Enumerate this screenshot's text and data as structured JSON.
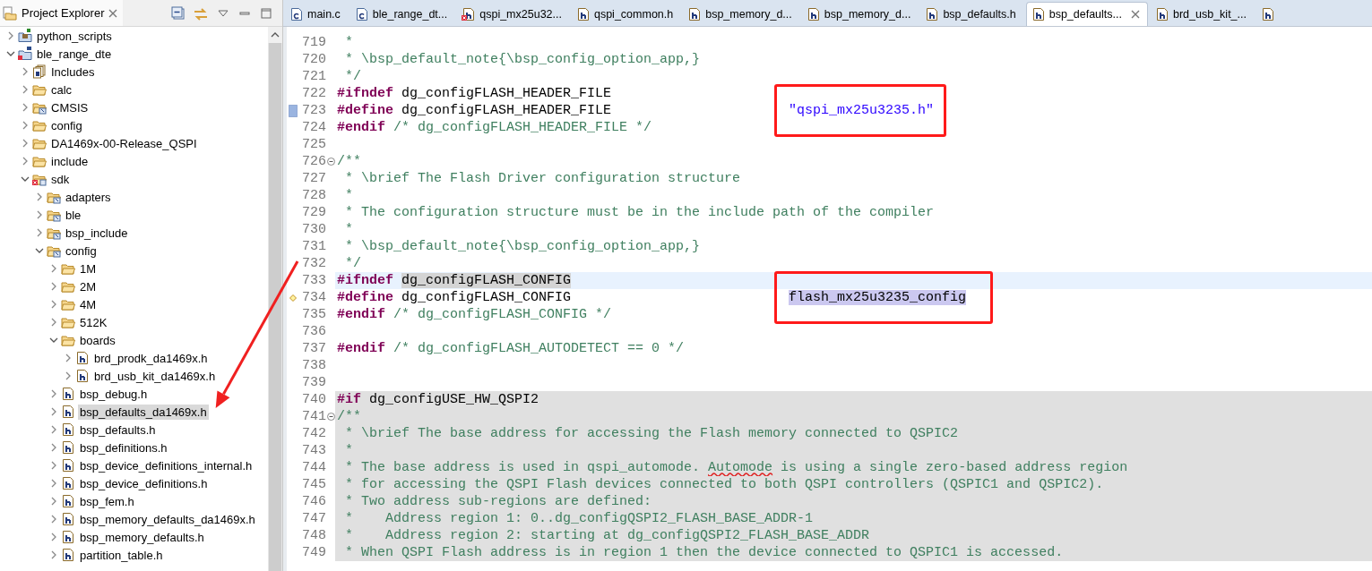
{
  "explorer": {
    "title": "Project Explorer",
    "tree": [
      {
        "label": "python_scripts",
        "kind": "python-project",
        "expanded": false,
        "selected": false
      },
      {
        "label": "ble_range_dte",
        "kind": "c-project",
        "expanded": true,
        "selected": false,
        "children": [
          {
            "label": "Includes",
            "kind": "includes",
            "expanded": false,
            "selected": false
          },
          {
            "label": "calc",
            "kind": "folder",
            "expanded": false,
            "selected": false
          },
          {
            "label": "CMSIS",
            "kind": "linked-folder",
            "expanded": false,
            "selected": false
          },
          {
            "label": "config",
            "kind": "folder",
            "expanded": false,
            "selected": false
          },
          {
            "label": "DA1469x-00-Release_QSPI",
            "kind": "folder",
            "expanded": false,
            "selected": false
          },
          {
            "label": "include",
            "kind": "folder",
            "expanded": false,
            "selected": false
          },
          {
            "label": "sdk",
            "kind": "error-folder",
            "expanded": true,
            "selected": false,
            "children": [
              {
                "label": "adapters",
                "kind": "linked-folder",
                "expanded": false,
                "selected": false
              },
              {
                "label": "ble",
                "kind": "linked-folder",
                "expanded": false,
                "selected": false
              },
              {
                "label": "bsp_include",
                "kind": "linked-folder",
                "expanded": false,
                "selected": false
              },
              {
                "label": "config",
                "kind": "linked-folder",
                "expanded": true,
                "selected": false,
                "children": [
                  {
                    "label": "1M",
                    "kind": "folder",
                    "expanded": false,
                    "selected": false
                  },
                  {
                    "label": "2M",
                    "kind": "folder",
                    "expanded": false,
                    "selected": false
                  },
                  {
                    "label": "4M",
                    "kind": "folder",
                    "expanded": false,
                    "selected": false
                  },
                  {
                    "label": "512K",
                    "kind": "folder",
                    "expanded": false,
                    "selected": false
                  },
                  {
                    "label": "boards",
                    "kind": "folder",
                    "expanded": true,
                    "selected": false,
                    "children": [
                      {
                        "label": "brd_prodk_da1469x.h",
                        "kind": "header",
                        "expanded": false,
                        "selected": false
                      },
                      {
                        "label": "brd_usb_kit_da1469x.h",
                        "kind": "header",
                        "expanded": false,
                        "selected": false
                      }
                    ]
                  },
                  {
                    "label": "bsp_debug.h",
                    "kind": "header",
                    "expanded": false,
                    "selected": false
                  },
                  {
                    "label": "bsp_defaults_da1469x.h",
                    "kind": "header",
                    "expanded": false,
                    "selected": true,
                    "pointed": true
                  },
                  {
                    "label": "bsp_defaults.h",
                    "kind": "header",
                    "expanded": false,
                    "selected": false
                  },
                  {
                    "label": "bsp_definitions.h",
                    "kind": "header",
                    "expanded": false,
                    "selected": false
                  },
                  {
                    "label": "bsp_device_definitions_internal.h",
                    "kind": "header",
                    "expanded": false,
                    "selected": false
                  },
                  {
                    "label": "bsp_device_definitions.h",
                    "kind": "header",
                    "expanded": false,
                    "selected": false
                  },
                  {
                    "label": "bsp_fem.h",
                    "kind": "header",
                    "expanded": false,
                    "selected": false
                  },
                  {
                    "label": "bsp_memory_defaults_da1469x.h",
                    "kind": "header",
                    "expanded": false,
                    "selected": false
                  },
                  {
                    "label": "bsp_memory_defaults.h",
                    "kind": "header",
                    "expanded": false,
                    "selected": false
                  },
                  {
                    "label": "partition_table.h",
                    "kind": "header",
                    "expanded": false,
                    "selected": false
                  }
                ]
              }
            ]
          }
        ]
      }
    ]
  },
  "editor": {
    "tabs": [
      {
        "label": "main.c",
        "kind": "c",
        "selected": false
      },
      {
        "label": "ble_range_dt...",
        "kind": "c",
        "selected": false
      },
      {
        "label": "qspi_mx25u32...",
        "kind": "h-error",
        "selected": false
      },
      {
        "label": "qspi_common.h",
        "kind": "h",
        "selected": false
      },
      {
        "label": "bsp_memory_d...",
        "kind": "h",
        "selected": false
      },
      {
        "label": "bsp_memory_d...",
        "kind": "h",
        "selected": false
      },
      {
        "label": "bsp_defaults.h",
        "kind": "h",
        "selected": false
      },
      {
        "label": "bsp_defaults...",
        "kind": "h",
        "selected": true
      },
      {
        "label": "brd_usb_kit_...",
        "kind": "h",
        "selected": false
      },
      {
        "kind": "h",
        "selected": false
      }
    ],
    "lines": [
      {
        "number": "719",
        "segments": [
          {
            "kind": "comment",
            "text": " *"
          }
        ]
      },
      {
        "number": "720",
        "segments": [
          {
            "kind": "comment",
            "text": " * \\bsp_default_note{\\bsp_config_option_app,}"
          }
        ]
      },
      {
        "number": "721",
        "segments": [
          {
            "kind": "comment",
            "text": " */"
          }
        ]
      },
      {
        "number": "722",
        "segments": [
          {
            "kind": "keyword",
            "text": "#ifndef"
          },
          {
            "kind": "plain",
            "text": "dg_configFLASH_HEADER_FILE"
          }
        ]
      },
      {
        "number": "723",
        "kind": "search-mark",
        "segments": [
          {
            "kind": "keyword",
            "text": "#define"
          },
          {
            "kind": "plain",
            "text": "dg_configFLASH_HEADER_FILE"
          },
          {
            "kind": "string",
            "text": "\"qspi_mx25u3235.h\"",
            "aligned": true,
            "boxed": true
          }
        ]
      },
      {
        "number": "724",
        "segments": [
          {
            "kind": "keyword",
            "text": "#endif"
          },
          {
            "kind": "comment",
            "text": "/* dg_configFLASH_HEADER_FILE */"
          }
        ]
      },
      {
        "number": "725"
      },
      {
        "number": "726",
        "foldable": true,
        "segments": [
          {
            "kind": "comment",
            "text": "/**"
          }
        ]
      },
      {
        "number": "727",
        "segments": [
          {
            "kind": "comment",
            "text": " * \\brief The Flash Driver configuration structure"
          }
        ]
      },
      {
        "number": "728",
        "segments": [
          {
            "kind": "comment",
            "text": " *"
          }
        ]
      },
      {
        "number": "729",
        "segments": [
          {
            "kind": "comment",
            "text": " * The configuration structure must be in the include path of the compiler"
          }
        ]
      },
      {
        "number": "730",
        "segments": [
          {
            "kind": "comment",
            "text": " *"
          }
        ]
      },
      {
        "number": "731",
        "segments": [
          {
            "kind": "comment",
            "text": " * \\bsp_default_note{\\bsp_config_option_app,}"
          }
        ]
      },
      {
        "number": "732",
        "segments": [
          {
            "kind": "comment",
            "text": " */"
          }
        ]
      },
      {
        "number": "733",
        "current": true,
        "segments": [
          {
            "kind": "keyword",
            "text": "#ifndef"
          },
          {
            "kind": "occurrence",
            "text": "dg_configFLASH_CONFIG"
          }
        ]
      },
      {
        "number": "734",
        "kind": "change-mark",
        "segments": [
          {
            "kind": "keyword",
            "text": "#define"
          },
          {
            "kind": "plain",
            "text": "dg_configFLASH_CONFIG"
          },
          {
            "kind": "selection",
            "text": "flash_mx25u3235_config",
            "aligned": true,
            "boxed": true
          }
        ]
      },
      {
        "number": "735",
        "segments": [
          {
            "kind": "keyword",
            "text": "#endif"
          },
          {
            "kind": "comment",
            "text": "/* dg_configFLASH_CONFIG */"
          }
        ]
      },
      {
        "number": "736"
      },
      {
        "number": "737",
        "segments": [
          {
            "kind": "keyword",
            "text": "#endif"
          },
          {
            "kind": "comment",
            "text": "/* dg_configFLASH_AUTODETECT == 0 */"
          }
        ]
      },
      {
        "number": "738"
      },
      {
        "number": "739"
      },
      {
        "number": "740",
        "inactive": true,
        "segments": [
          {
            "kind": "keyword",
            "text": "#if"
          },
          {
            "kind": "plain",
            "text": "dg_configUSE_HW_QSPI2"
          }
        ]
      },
      {
        "number": "741",
        "inactive": true,
        "foldable": true,
        "segments": [
          {
            "kind": "comment",
            "text": "/**"
          }
        ]
      },
      {
        "number": "742",
        "inactive": true,
        "segments": [
          {
            "kind": "comment",
            "text": " * \\brief The base address for accessing the Flash memory connected to QSPIC2"
          }
        ]
      },
      {
        "number": "743",
        "inactive": true,
        "segments": [
          {
            "kind": "comment",
            "text": " *"
          }
        ]
      },
      {
        "number": "744",
        "inactive": true,
        "segments": [
          {
            "kind": "comment",
            "text": " * The base address is used in qspi_automode."
          },
          {
            "kind": "comment",
            "text": "Automode",
            "misspelled": true
          },
          {
            "kind": "comment",
            "text": "is using a single zero-based address region"
          }
        ]
      },
      {
        "number": "745",
        "inactive": true,
        "segments": [
          {
            "kind": "comment",
            "text": " * for accessing the QSPI Flash devices connected to both QSPI controllers (QSPIC1 and QSPIC2)."
          }
        ]
      },
      {
        "number": "746",
        "inactive": true,
        "segments": [
          {
            "kind": "comment",
            "text": " * Two address sub-regions are defined:"
          }
        ]
      },
      {
        "number": "747",
        "inactive": true,
        "segments": [
          {
            "kind": "comment",
            "text": " *    Address region 1: 0..dg_configQSPI2_FLASH_BASE_ADDR-1"
          }
        ]
      },
      {
        "number": "748",
        "inactive": true,
        "segments": [
          {
            "kind": "comment",
            "text": " *    Address region 2: starting at dg_configQSPI2_FLASH_BASE_ADDR"
          }
        ]
      },
      {
        "number": "749",
        "inactive": true,
        "segments": [
          {
            "kind": "comment",
            "text": " * When QSPI Flash address is in region 1 then the device connected to QSPIC1 is accessed."
          }
        ]
      }
    ]
  }
}
